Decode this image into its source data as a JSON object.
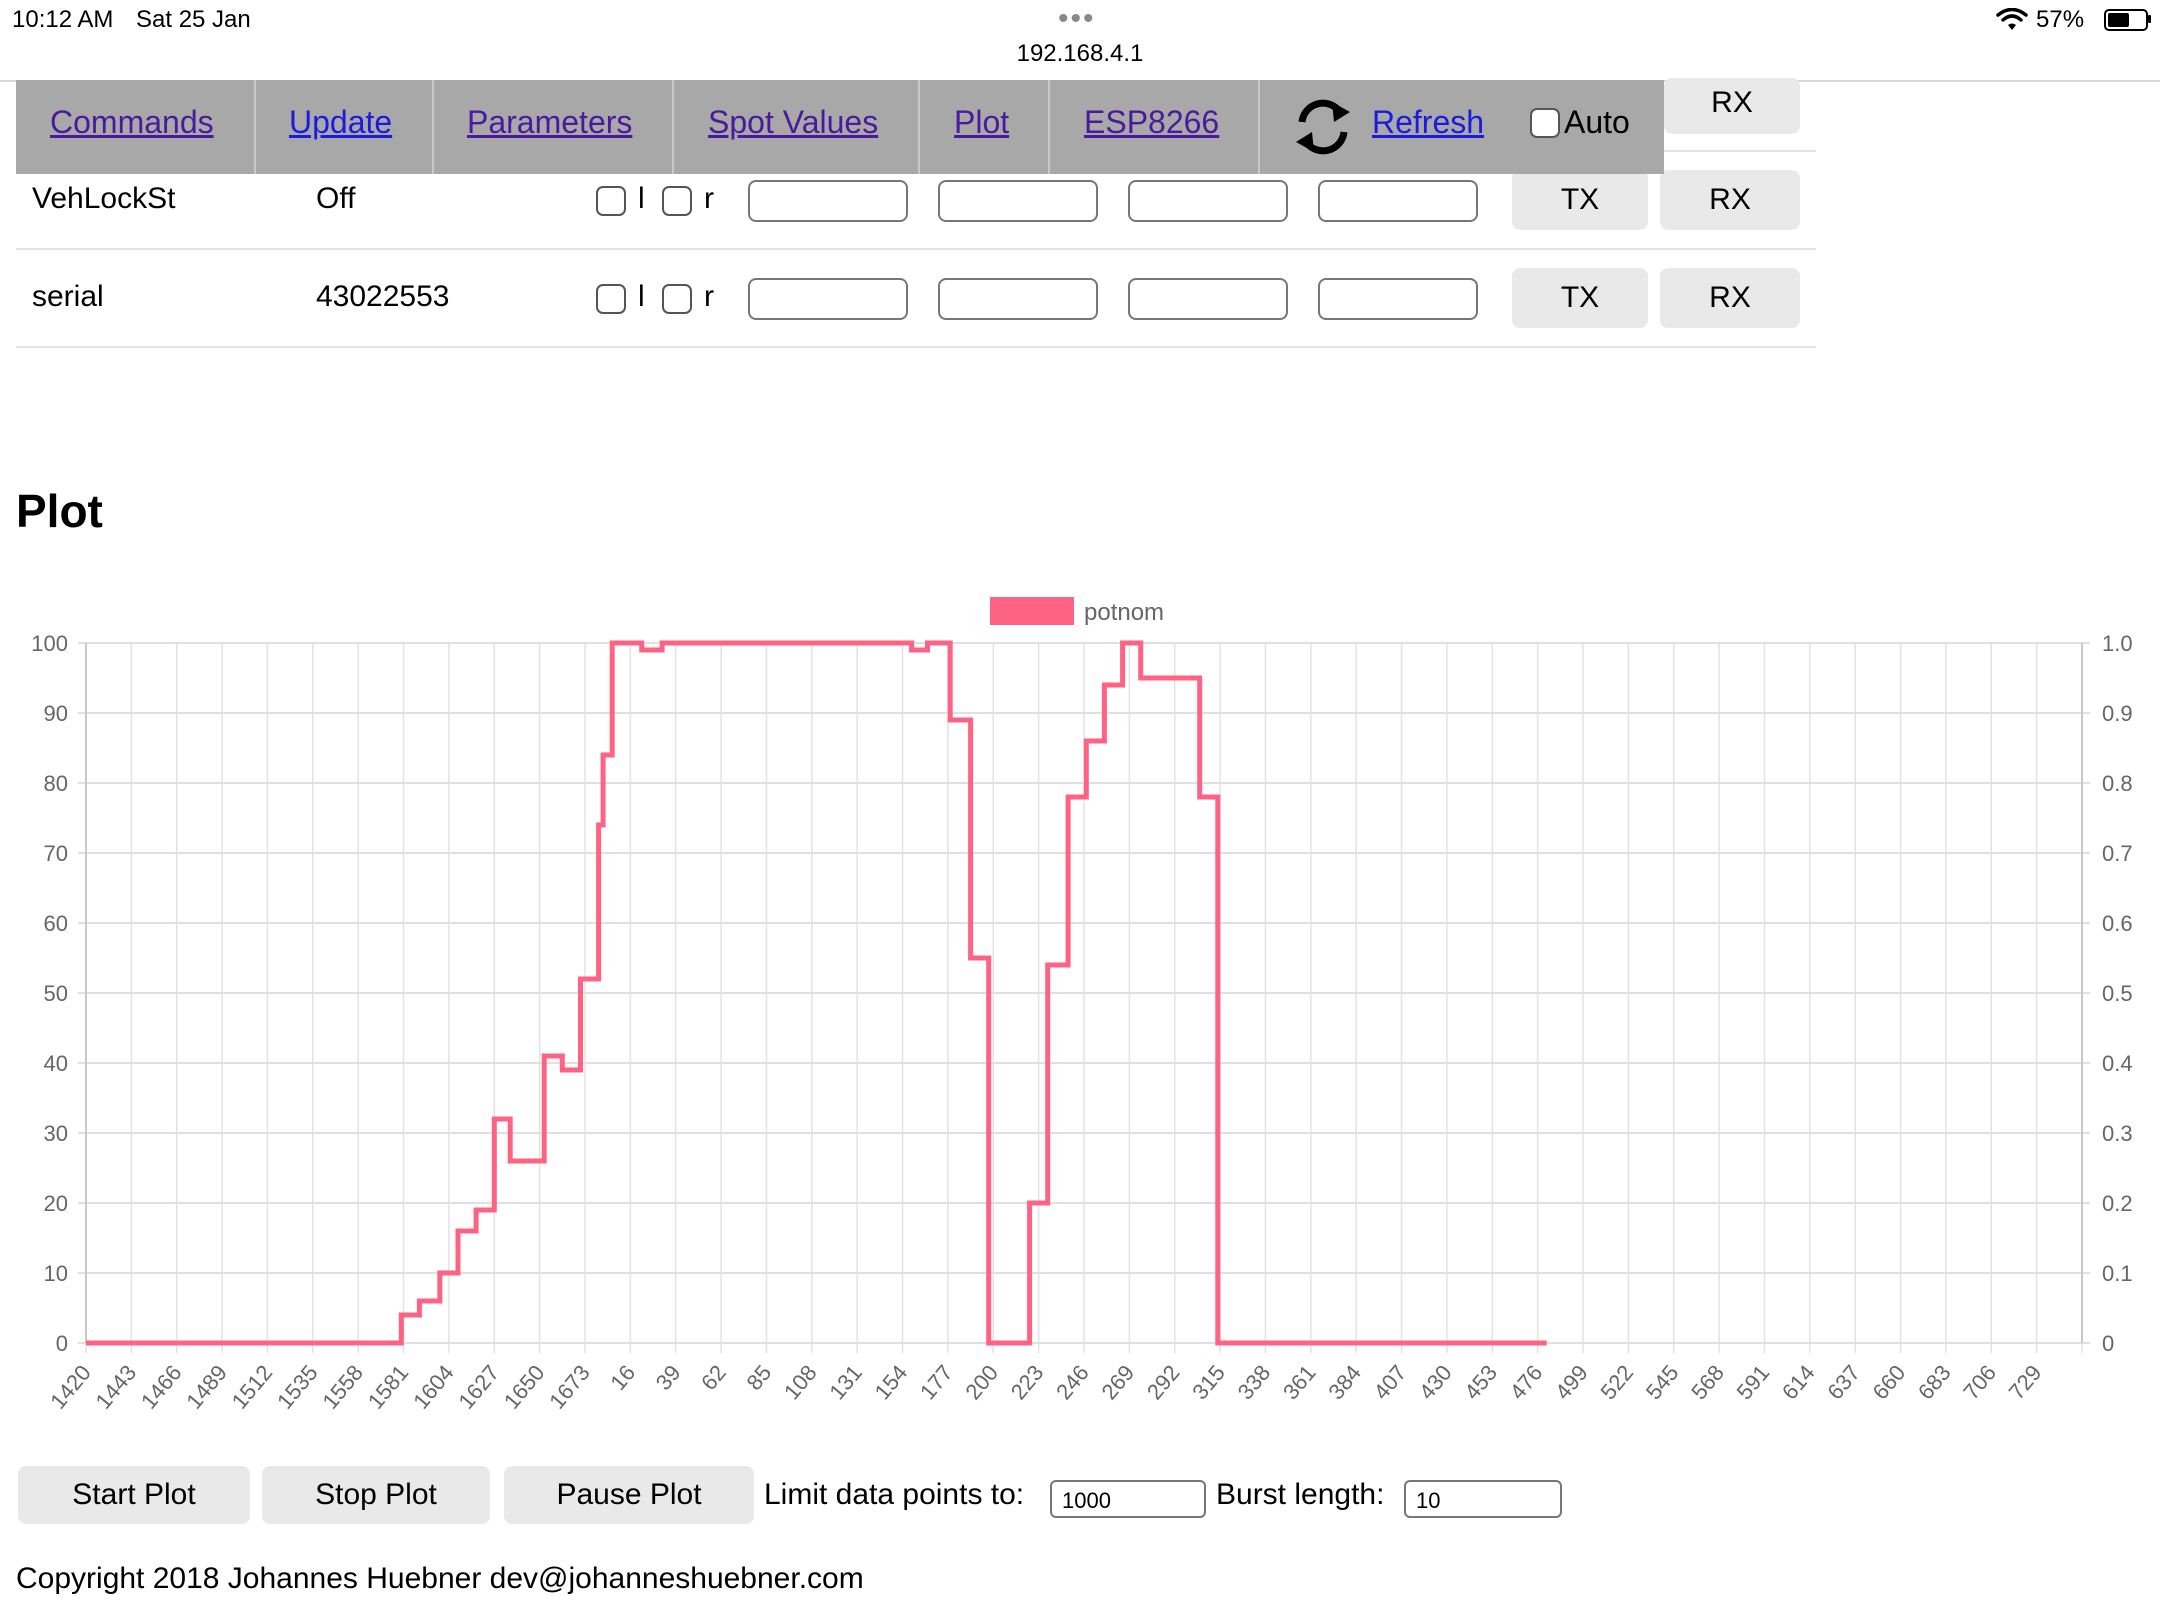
{
  "status_bar": {
    "time": "10:12 AM",
    "date": "Sat 25 Jan",
    "url": "192.168.4.1",
    "battery": "57%",
    "battery_level": 0.57
  },
  "nav": {
    "items": [
      "Commands",
      "Update",
      "Parameters",
      "Spot Values",
      "Plot",
      "ESP8266"
    ],
    "refresh": "Refresh",
    "auto": "Auto",
    "rx_partial": "RX"
  },
  "rows": [
    {
      "name": "VehLockSt",
      "value": "Off",
      "l": "l",
      "r": "r",
      "tx": "TX",
      "rx": "RX"
    },
    {
      "name": "serial",
      "value": "43022553",
      "l": "l",
      "r": "r",
      "tx": "TX",
      "rx": "RX"
    }
  ],
  "plot": {
    "heading": "Plot",
    "start": "Start Plot",
    "stop": "Stop Plot",
    "pause": "Pause Plot",
    "limit_label": "Limit data points to:",
    "limit_value": "1000",
    "burst_label": "Burst length:",
    "burst_value": "10"
  },
  "footer": {
    "copyright": "Copyright 2018 Johannes Huebner dev@johanneshuebner.com"
  },
  "colors": {
    "series": "#ff6384",
    "nav_bg": "#a8a8a8",
    "link": "#4a1a9e"
  },
  "chart_data": {
    "type": "line",
    "step": true,
    "legend_placement": "top-center",
    "grid": true,
    "ylim": [
      0,
      100
    ],
    "y_ticks": [
      "0",
      "10",
      "20",
      "30",
      "40",
      "50",
      "60",
      "70",
      "80",
      "90",
      "100"
    ],
    "y2_ticks": [
      "0",
      "0.1",
      "0.2",
      "0.3",
      "0.4",
      "0.5",
      "0.6",
      "0.7",
      "0.8",
      "0.9",
      "1.0"
    ],
    "categories": [
      "1420",
      "1443",
      "1466",
      "1489",
      "1512",
      "1535",
      "1558",
      "1581",
      "1604",
      "1627",
      "1650",
      "1673",
      "16",
      "39",
      "62",
      "85",
      "108",
      "131",
      "154",
      "177",
      "200",
      "223",
      "246",
      "269",
      "292",
      "315",
      "338",
      "361",
      "384",
      "407",
      "430",
      "453",
      "476",
      "499",
      "522",
      "545",
      "568",
      "591",
      "614",
      "637",
      "660",
      "683",
      "706",
      "729"
    ],
    "series": [
      {
        "name": "potnom",
        "points": [
          [
            0,
            0
          ],
          [
            6.95,
            0
          ],
          [
            6.95,
            4
          ],
          [
            7.35,
            4
          ],
          [
            7.35,
            6
          ],
          [
            7.8,
            6
          ],
          [
            7.8,
            10
          ],
          [
            8.2,
            10
          ],
          [
            8.2,
            16
          ],
          [
            8.6,
            16
          ],
          [
            8.6,
            19
          ],
          [
            9.0,
            19
          ],
          [
            9.0,
            32
          ],
          [
            9.35,
            32
          ],
          [
            9.35,
            26
          ],
          [
            10.1,
            26
          ],
          [
            10.1,
            41
          ],
          [
            10.5,
            41
          ],
          [
            10.5,
            39
          ],
          [
            10.9,
            39
          ],
          [
            10.9,
            52
          ],
          [
            11.3,
            52
          ],
          [
            11.3,
            74
          ],
          [
            11.4,
            74
          ],
          [
            11.4,
            84
          ],
          [
            11.6,
            84
          ],
          [
            11.6,
            100
          ],
          [
            12.25,
            100
          ],
          [
            12.25,
            99
          ],
          [
            12.7,
            99
          ],
          [
            12.7,
            100
          ],
          [
            18.2,
            100
          ],
          [
            18.2,
            99
          ],
          [
            18.55,
            99
          ],
          [
            18.55,
            100
          ],
          [
            19.05,
            100
          ],
          [
            19.05,
            89
          ],
          [
            19.5,
            89
          ],
          [
            19.5,
            55
          ],
          [
            19.9,
            55
          ],
          [
            19.9,
            0
          ],
          [
            20.8,
            0
          ],
          [
            20.8,
            20
          ],
          [
            21.2,
            20
          ],
          [
            21.2,
            54
          ],
          [
            21.65,
            54
          ],
          [
            21.65,
            78
          ],
          [
            22.05,
            78
          ],
          [
            22.05,
            86
          ],
          [
            22.45,
            86
          ],
          [
            22.45,
            94
          ],
          [
            22.85,
            94
          ],
          [
            22.85,
            100
          ],
          [
            23.25,
            100
          ],
          [
            23.25,
            95
          ],
          [
            24.55,
            95
          ],
          [
            24.55,
            78
          ],
          [
            24.95,
            78
          ],
          [
            24.95,
            0
          ],
          [
            32.2,
            0
          ]
        ]
      }
    ]
  }
}
